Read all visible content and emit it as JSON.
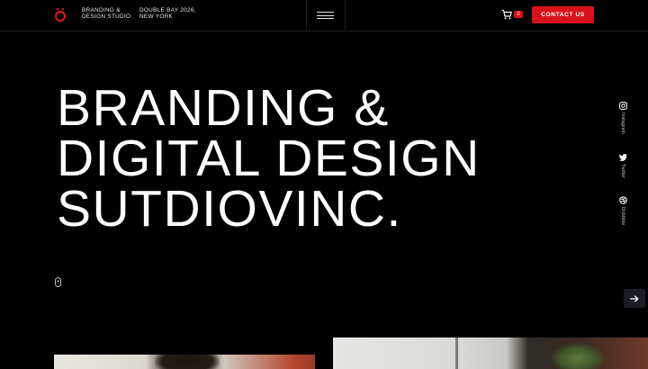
{
  "header": {
    "logo_icon": "o-umlaut-logo-icon",
    "tagline_studio": "BRANDING &\nDESIGN STUDIO",
    "tagline_address": "DOUBLE BAY 2026,\nNEW YORK",
    "menu_icon": "hamburger-menu-icon",
    "cart_icon": "cart-icon",
    "cart_count": "0",
    "contact_label": "CONTACT US"
  },
  "hero": {
    "line1": "BRANDING &",
    "line2": "DIGITAL DESIGN",
    "line3": "SUTDIOVINC."
  },
  "social": [
    {
      "label": "Instagram",
      "icon": "instagram-icon"
    },
    {
      "label": "Twitter",
      "icon": "twitter-icon"
    },
    {
      "label": "Dribbble",
      "icon": "dribbble-icon"
    }
  ],
  "controls": {
    "next_icon": "arrow-right-icon",
    "scroll_icon": "mouse-scroll-icon"
  },
  "colors": {
    "accent": "#d7121a",
    "background": "#000000",
    "text": "#ffffff"
  }
}
